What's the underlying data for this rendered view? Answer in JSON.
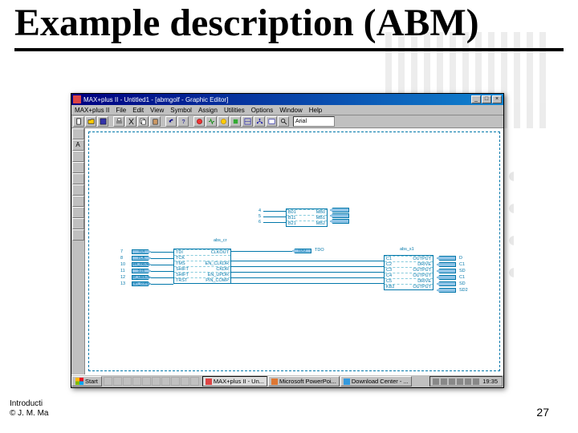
{
  "slide": {
    "title": "Example description (ABM)",
    "footer_line1": "Introducti",
    "footer_line2": "© J. M. Ma",
    "page_number": "27"
  },
  "app": {
    "title": "MAX+plus II - Untitled1 - [abmgolf - Graphic Editor]",
    "window_buttons": [
      "_",
      "□",
      "×"
    ],
    "menus": [
      "MAX+plus II",
      "File",
      "Edit",
      "View",
      "Symbol",
      "Assign",
      "Utilities",
      "Options",
      "Window",
      "Help"
    ],
    "font": "Arial",
    "palette": [
      "",
      "A",
      "",
      "",
      "",
      "",
      "",
      "",
      "",
      ""
    ],
    "schematic": {
      "top_block": {
        "name": "",
        "inputs": [
          {
            "num": "4",
            "name": "B01"
          },
          {
            "num": "5",
            "name": "B11"
          },
          {
            "num": "6",
            "name": "B21"
          }
        ],
        "outputs": [
          "MB0",
          "MB1",
          "MB2"
        ]
      },
      "left_block": {
        "name": "abs_cr",
        "pins": [
          {
            "num": "7",
            "in": "TDI",
            "l": "TDI",
            "r": "CLKOUT"
          },
          {
            "num": "8",
            "in": "TCK",
            "l": "TCK",
            "r": ""
          },
          {
            "num": "10",
            "in": "en_ckDR",
            "l": "TMS",
            "r": "EN_CLKDR"
          },
          {
            "num": "11",
            "in": "S16",
            "l": "SHIFT",
            "r": "CKDR"
          },
          {
            "num": "12",
            "in": "sr_usbDR",
            "l": "SHIFT",
            "r": "EN_UPDR"
          },
          {
            "num": "13",
            "in": "pin_comp",
            "l": "TRST",
            "r": "PIN_COMP"
          }
        ]
      },
      "right_block": {
        "name": "abs_s1",
        "pins": [
          {
            "l": "C1",
            "r": "OUTPUT",
            "out": "D"
          },
          {
            "l": "C2",
            "r": "DRIVE",
            "out": "C1"
          },
          {
            "l": "C3",
            "r": "OUTPUT",
            "out": "SD"
          },
          {
            "l": "C4",
            "r": "OUTPUT",
            "out": "C1"
          },
          {
            "l": "C5",
            "r": "DRIVE",
            "out": "SD"
          },
          {
            "l": "KB2",
            "r": "OUTPUT",
            "out": "SD2"
          }
        ]
      },
      "tdo_port": "TDO"
    }
  },
  "taskbar": {
    "start": "Start",
    "tasks": [
      {
        "label": "MAX+plus II - Un...",
        "active": true
      },
      {
        "label": "Microsoft PowerPoi...",
        "active": false
      },
      {
        "label": "Download Center - ...",
        "active": false
      }
    ],
    "clock": "19:35"
  }
}
